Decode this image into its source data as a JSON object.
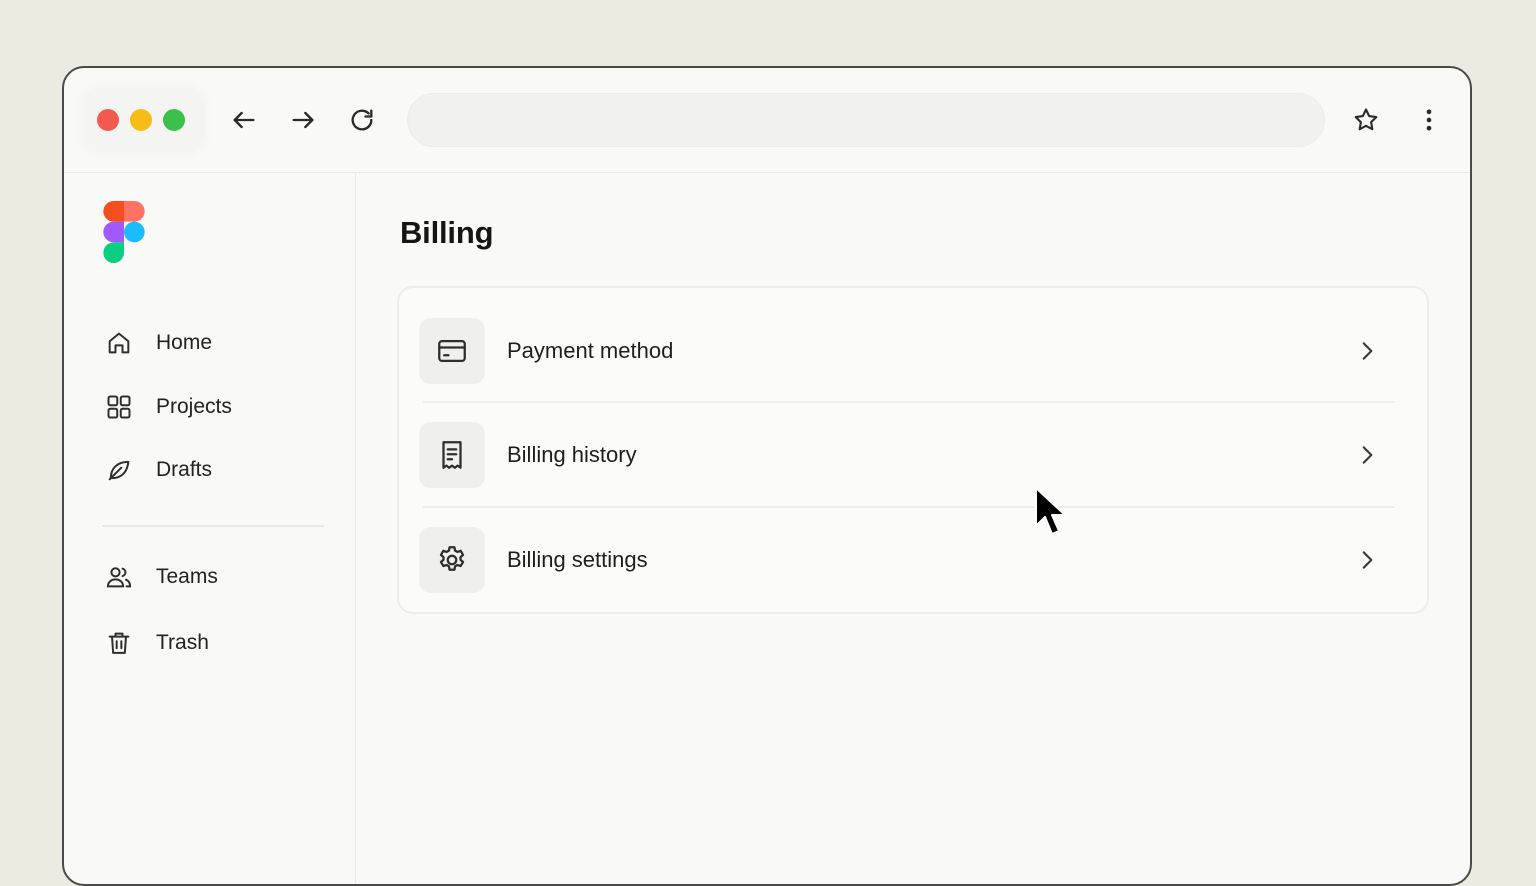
{
  "browser": {
    "nav": {
      "back_icon": "arrow-left-icon",
      "forward_icon": "arrow-right-icon",
      "reload_icon": "reload-icon",
      "bookmark_icon": "star-icon",
      "menu_icon": "kebab-menu-icon"
    },
    "address_value": "",
    "traffic_colors": [
      "#f25a4f",
      "#f6bd16",
      "#3cbf4b"
    ]
  },
  "sidebar": {
    "logo": "figma-logo",
    "items": [
      {
        "label": "Home",
        "icon": "home-icon"
      },
      {
        "label": "Projects",
        "icon": "grid-icon"
      },
      {
        "label": "Drafts",
        "icon": "leaf-icon"
      },
      {
        "label": "Teams",
        "icon": "users-icon"
      },
      {
        "label": "Trash",
        "icon": "trash-icon"
      }
    ]
  },
  "main": {
    "title": "Billing",
    "rows": [
      {
        "label": "Payment method",
        "icon": "credit-card-icon"
      },
      {
        "label": "Billing history",
        "icon": "receipt-icon"
      },
      {
        "label": "Billing settings",
        "icon": "gear-icon"
      }
    ]
  }
}
